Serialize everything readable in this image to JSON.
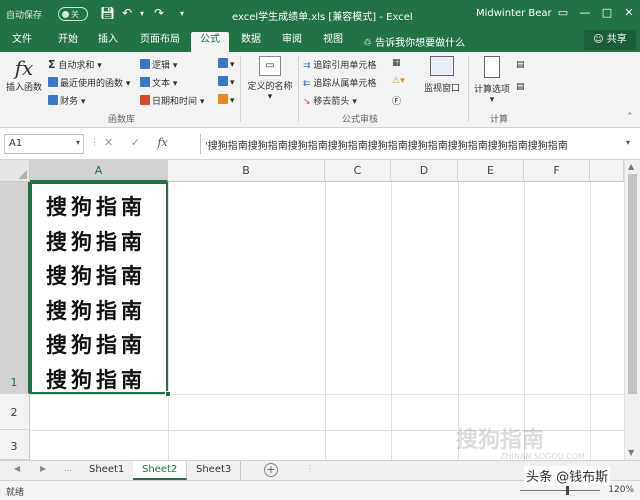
{
  "window": {
    "autosave_label": "自动保存",
    "autosave_state": "关",
    "title": "excel学生成绩单.xls [兼容模式] - Excel",
    "user": "Midwinter Bear",
    "accent": "#217346"
  },
  "tabs": [
    "文件",
    "开始",
    "插入",
    "页面布局",
    "公式",
    "数据",
    "审阅",
    "视图"
  ],
  "active_tab": "公式",
  "tell_me": "告诉我你想要做什么",
  "share": "共享",
  "ribbon": {
    "insert_function": "插入函数",
    "autosum": "自动求和",
    "recent": "最近使用的函数",
    "financial": "财务",
    "logical": "逻辑",
    "text": "文本",
    "datetime": "日期和时间",
    "group_function_library": "函数库",
    "define_name": "定义的名称",
    "trace_precedents": "追踪引用单元格",
    "trace_dependents": "追踪从属单元格",
    "remove_arrows": "移去箭头",
    "group_formula_auditing": "公式审核",
    "watch_window": "监视窗口",
    "calc_options": "计算选项",
    "group_calculation": "计算"
  },
  "formula_bar": {
    "name_box": "A1",
    "cancel": "✕",
    "enter": "✓",
    "fx": "fx",
    "content": "'搜狗指南搜狗指南搜狗指南搜狗指南搜狗指南搜狗指南搜狗指南搜狗指南搜狗指南"
  },
  "grid": {
    "columns": [
      "A",
      "B",
      "C",
      "D",
      "E",
      "F"
    ],
    "rows": [
      "1",
      "2",
      "3"
    ],
    "cell_a1_lines": [
      "搜狗指南",
      "搜狗指南",
      "搜狗指南",
      "搜狗指南",
      "搜狗指南",
      "搜狗指南"
    ]
  },
  "sheets": [
    "Sheet1",
    "Sheet2",
    "Sheet3"
  ],
  "active_sheet": "Sheet2",
  "status": {
    "ready": "就绪",
    "zoom": "120%"
  },
  "watermark": {
    "logo": "搜狗指南",
    "sub": "ZHINAN.SOGOU.COM",
    "credit": "头条 @钱布斯"
  }
}
